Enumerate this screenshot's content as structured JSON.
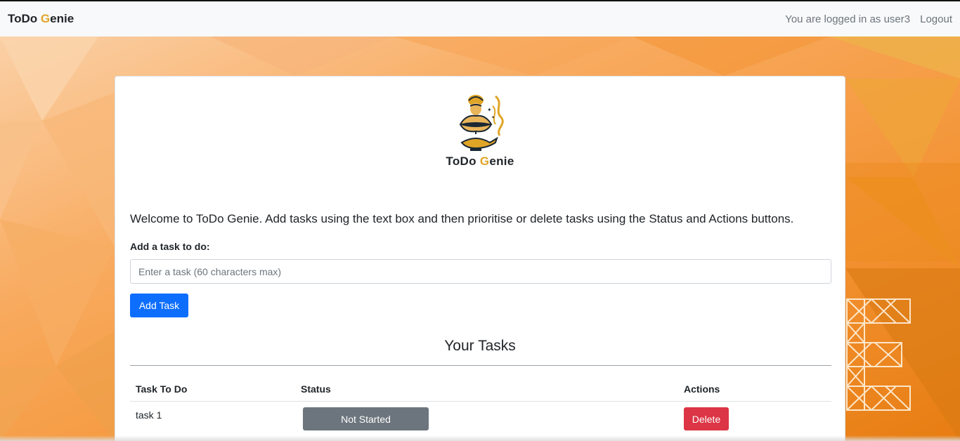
{
  "navbar": {
    "brand_part1": "ToDo ",
    "brand_g": "G",
    "brand_part2": "enie",
    "logged_in_text": "You are logged in as user3",
    "logout_label": "Logout"
  },
  "logo": {
    "text_part1": "ToDo ",
    "text_g": "G",
    "text_part2": "enie",
    "icon": "genie-lamp-icon"
  },
  "main": {
    "welcome_text": "Welcome to ToDo Genie. Add tasks using the text box and then prioritise or delete tasks using the Status and Actions buttons.",
    "add_task_label": "Add a task to do:",
    "task_input_value": "",
    "task_input_placeholder": "Enter a task (60 characters max)",
    "add_task_button": "Add Task",
    "tasks_title": "Your Tasks"
  },
  "table": {
    "headers": [
      "Task To Do",
      "Status",
      "Actions"
    ],
    "rows": [
      {
        "task": "task 1",
        "status": "Not Started",
        "action": "Delete"
      }
    ]
  },
  "colors": {
    "brand_accent": "#e0a526",
    "primary": "#0d6efd",
    "secondary": "#6c757d",
    "danger": "#dc3545",
    "background": "#f59a3a"
  }
}
